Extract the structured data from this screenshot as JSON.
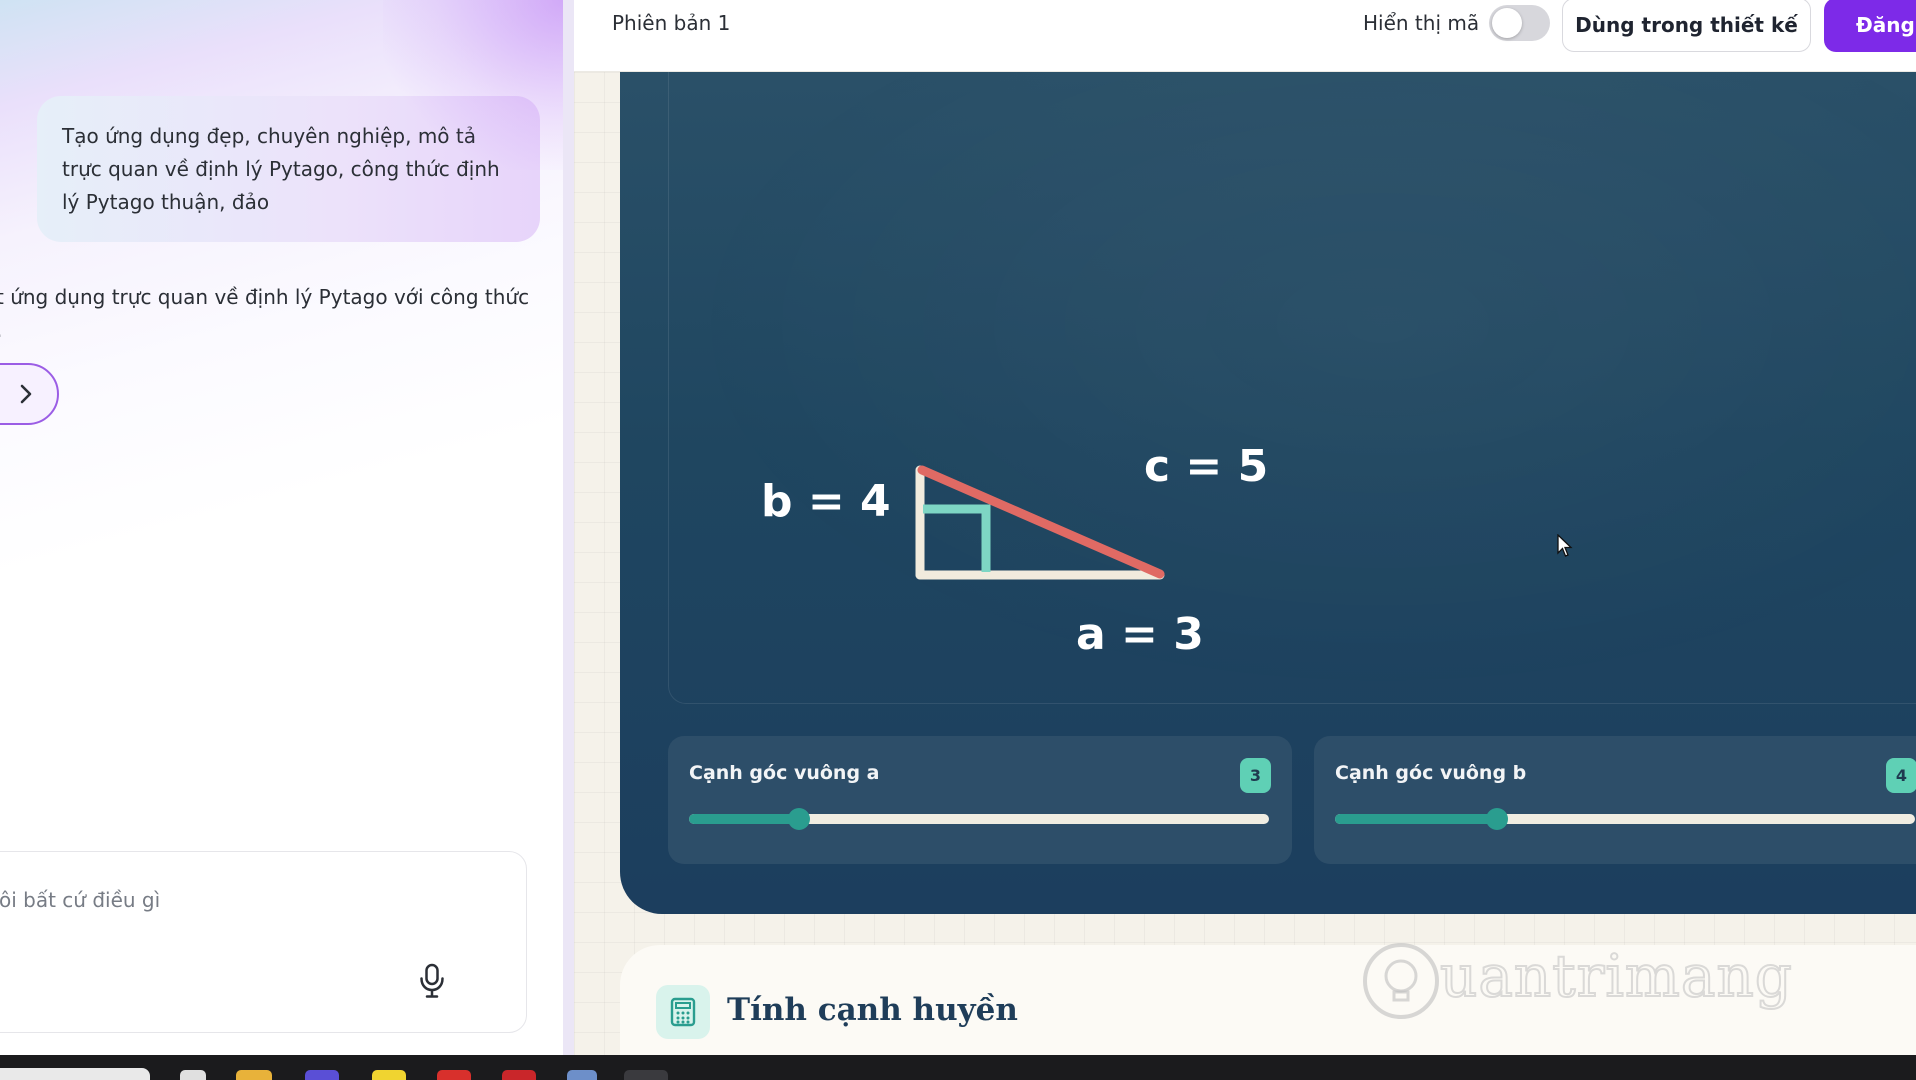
{
  "chat": {
    "user_message": "Tạo ứng dụng đẹp, chuyên nghiệp, mô tả trực quan về định lý Pytago, công thức định lý Pytago thuận, đảo",
    "assistant_message_line1": "t ứng dụng trực quan về định lý Pytago với công thức",
    "assistant_message_line2": ".",
    "expand_icon": "chevron-right-icon",
    "input_placeholder": "ôi bất cứ điều gì",
    "mic_icon": "microphone-icon"
  },
  "topbar": {
    "version_label": "Phiên bản 1",
    "show_code_label": "Hiển thị mã",
    "show_code_enabled": false,
    "use_in_design_label": "Dùng trong thiết kế",
    "publish_label": "Đăng"
  },
  "visualization": {
    "label_b": "b = 4",
    "label_c": "c = 5",
    "label_a": "a = 3",
    "colors": {
      "legs": "#f1ebdd",
      "hypotenuse": "#e06a64",
      "right_angle_square": "#7ed6c4",
      "card_bg": "#1f4660"
    }
  },
  "sliders": [
    {
      "label": "Cạnh góc vuông a",
      "value": "3",
      "fraction": 0.19
    },
    {
      "label": "Cạnh góc vuông b",
      "value": "4",
      "fraction": 0.28
    }
  ],
  "hypotenuse_section": {
    "title": "Tính cạnh huyền",
    "icon": "calculator-icon"
  },
  "watermark": {
    "text": "uantrimang",
    "icon": "lightbulb-icon"
  }
}
